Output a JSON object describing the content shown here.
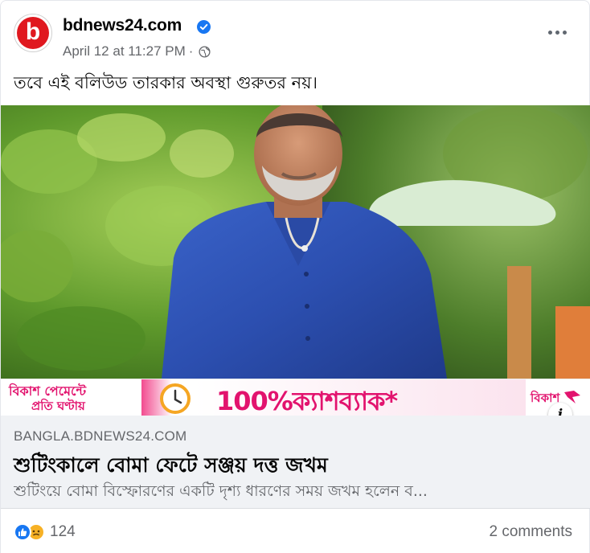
{
  "post": {
    "page_name": "bdnews24.com",
    "avatar_letter": "b",
    "timestamp": "April 12 at 11:27 PM",
    "separator": "·",
    "text": "তবে এই বলিউড তারকার অবস্থা গুরুতর নয়।"
  },
  "banner": {
    "left_line1": "বিকাশ পেমেন্টে",
    "left_line2": "প্রতি ঘণ্টায়",
    "main": "100%ক্যাশব্যাক*",
    "brand": "বিকাশ"
  },
  "link_preview": {
    "domain": "BANGLA.BDNEWS24.COM",
    "headline": "শুটিংকালে বোমা ফেটে সঞ্জয় দত্ত জখম",
    "description": "শুটিংয়ে বোমা বিস্ফোরণের একটি দৃশ্য ধারণের সময় জখম হলেন ব..."
  },
  "footer": {
    "reaction_count": "124",
    "comments": "2 comments"
  },
  "icons": {
    "verified": "verified-badge-icon",
    "audience": "globe-icon",
    "more": "more-options-icon",
    "info": "info-icon",
    "reaction_like": "like-reaction-icon",
    "reaction_sad": "sad-reaction-icon"
  },
  "colors": {
    "brand_red": "#e0181f",
    "facebook_blue": "#1877f2",
    "bkash_pink": "#e2136e",
    "secondary_text": "#65676b",
    "link_bg": "#f0f2f5"
  }
}
